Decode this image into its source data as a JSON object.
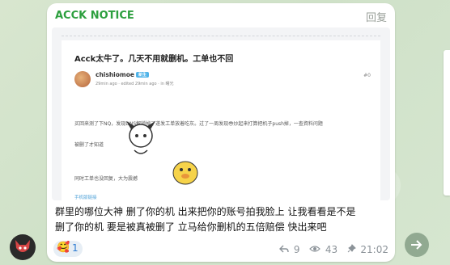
{
  "message": {
    "sender": "ACCK NOTICE",
    "reply_label": "回复",
    "text_line1": "群里的哪位大神 删了你的机 出来把你的账号拍我脸上 让我看看是不是",
    "text_line2": "删了你的机 要是被真被删了 立马给你删机的五倍赔偿    快出来吧",
    "reaction_emoji": "🥰",
    "reaction_count": "1",
    "replies_count": "9",
    "views_count": "43",
    "time": "21:02"
  },
  "screenshot_post": {
    "title": "Acck太牛了。几天不用就删机。工单也不回",
    "author": "chishiomoe",
    "author_tag": "新生",
    "meta": "29min ago · edited 29min ago · in 曙光",
    "post_number": "#0",
    "paragraph1": "买回来测了下NQ，发现DNS解锁掉了遂发工单放着吃灰。过了一周发现😳炒起来打算把机子push掉，一查資料问题",
    "paragraph2": "被删了才知道",
    "paragraph3": "同时工单也没回复，大为震撼",
    "footer_link": "手机版链接"
  },
  "icons": {
    "avatar": "wolf-avatar-icon",
    "forward": "forward-arrow-icon",
    "replies": "reply-arrow-icon",
    "views": "eye-icon",
    "pinned": "pin-icon"
  },
  "colors": {
    "sender": "#2c9f3e",
    "link": "#4fa2d8",
    "meta": "#8c9399"
  }
}
